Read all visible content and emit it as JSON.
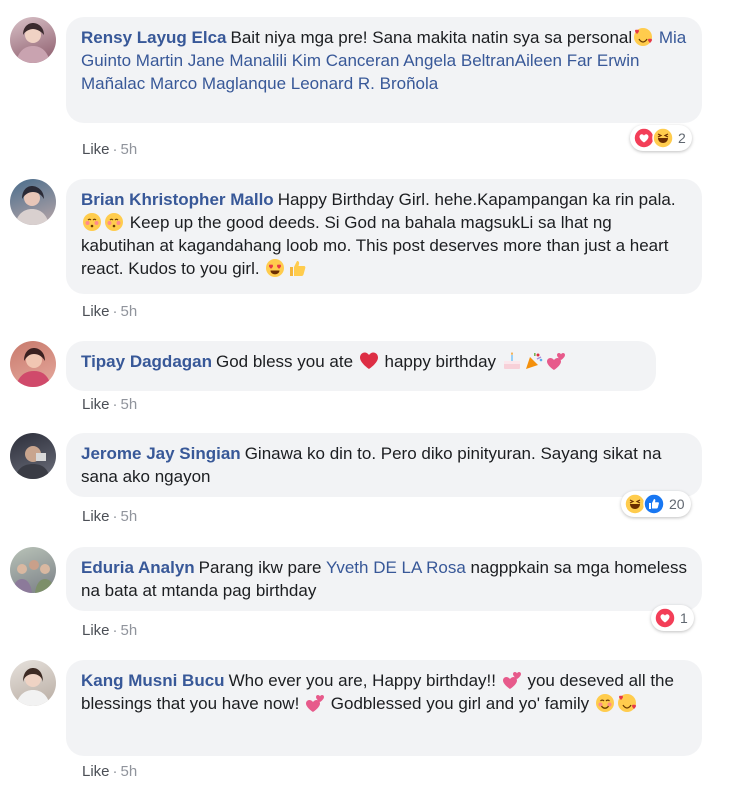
{
  "comments": [
    {
      "author": "Rensy Layug Elca",
      "text_a": "Bait niya mga pre! Sana makita natin sya sa personal",
      "tags": "Mia Guinto Martin Jane Manalili Kim Canceran Angela BeltranAileen Far Erwin Mañalac Marco Maglanque Leonard R. Broñola",
      "like_label": "Like",
      "time": "5h",
      "reaction_count": "2",
      "reactions": [
        "love",
        "haha"
      ]
    },
    {
      "author": "Brian Khristopher Mallo",
      "text_a": "Happy Birthday Girl. hehe.Kapampangan ka rin pala.",
      "text_b": "Keep up the good deeds. Si God na bahala magsukLi sa lhat ng kabutihan at kagandahang loob mo. This post deserves more than just a heart react. Kudos to you girl.",
      "like_label": "Like",
      "time": "5h"
    },
    {
      "author": "Tipay Dagdagan",
      "text_a": "God bless you ate",
      "text_b": "happy birthday",
      "like_label": "Like",
      "time": "5h"
    },
    {
      "author": "Jerome Jay Singian",
      "text_a": "Ginawa ko din to. Pero diko pinityuran. Sayang sikat na sana ako ngayon",
      "like_label": "Like",
      "time": "5h",
      "reaction_count": "20",
      "reactions": [
        "haha",
        "like"
      ]
    },
    {
      "author": "Eduria Analyn",
      "text_a": "Parang ikw pare",
      "tag": "Yveth DE LA Rosa",
      "text_b": "nagppkain sa mga homeless na bata at mtanda pag birthday",
      "like_label": "Like",
      "time": "5h",
      "reaction_count": "1",
      "reactions": [
        "love"
      ]
    },
    {
      "author": "Kang Musni Bucu",
      "text_a": "Who ever you are, Happy birthday!!",
      "text_b": "you deseved all the blessings that you have now!",
      "text_c": "Godblessed you girl and yo' family",
      "like_label": "Like",
      "time": "5h"
    }
  ],
  "separator": "·",
  "colors": {
    "author": "#385898",
    "bubble": "#f2f3f5",
    "meta": "#90949c",
    "love": "#f33e58",
    "like": "#1877f2",
    "emoji": "#ffcc4d"
  },
  "icons": [
    "avatar",
    "love-react-icon",
    "haha-react-icon",
    "like-react-icon",
    "smiling-face-with-hearts-emoji",
    "heart-eyes-emoji",
    "thumbs-up-emoji",
    "red-heart-emoji",
    "birthday-cake-emoji",
    "party-popper-emoji",
    "two-hearts-emoji",
    "blush-emoji"
  ]
}
